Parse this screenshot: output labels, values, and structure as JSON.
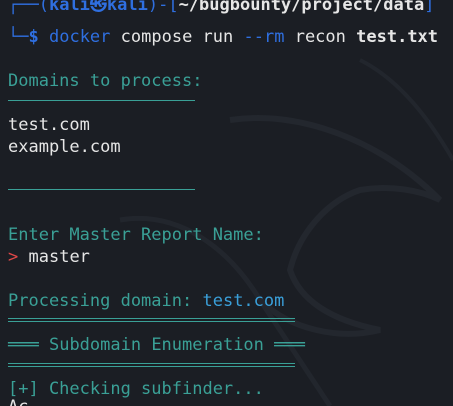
{
  "prompt": {
    "kali_user": "kali",
    "kali_symbol": "㉿",
    "kali_host": "kali",
    "path": "~/bugbounty/project/data",
    "dollar": "$",
    "cmd_docker": "docker",
    "cmd_args": "compose run",
    "cmd_flag": "--rm",
    "cmd_image": "recon",
    "cmd_file": "test.txt"
  },
  "output": {
    "domains_header": "Domains to process:",
    "domains": [
      "test.com",
      "example.com"
    ],
    "report_prompt": "Enter Master Report Name:",
    "arrow": ">",
    "report_name": "master",
    "processing_label": "Processing domain:",
    "processing_domain": "test.com",
    "section_title": "Subdomain Enumeration",
    "section_bars_left": "═══",
    "section_bars_right": "═══",
    "checking": "[+] Checking subfinder...",
    "partial": "Ac"
  },
  "colors": {
    "background": "#1b1e24",
    "prompt_blue": "#2f6fe0",
    "teal": "#3aa096",
    "white": "#e6e6e6",
    "red": "#e04848"
  }
}
